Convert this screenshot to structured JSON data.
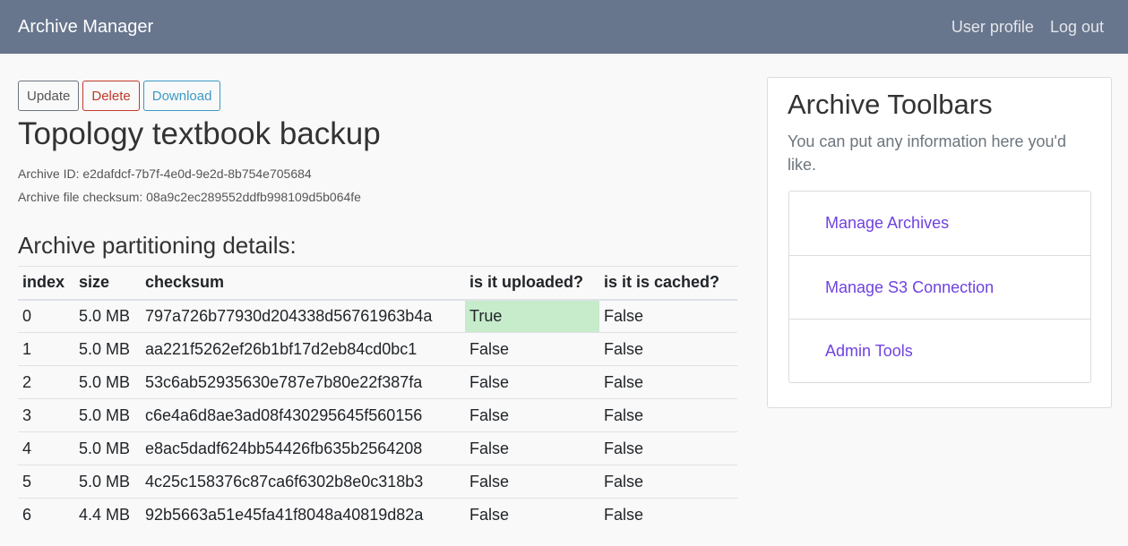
{
  "navbar": {
    "brand": "Archive Manager",
    "links": [
      "User profile",
      "Log out"
    ]
  },
  "actions": {
    "update_label": "Update",
    "delete_label": "Delete",
    "download_label": "Download"
  },
  "archive": {
    "title": "Topology textbook backup",
    "id_text": "Archive ID: e2dafdcf-7b7f-4e0d-9e2d-8b754e705684",
    "checksum_text": "Archive file checksum: 08a9c2ec289552ddfb998109d5b064fe"
  },
  "partitions": {
    "heading": "Archive partitioning details:",
    "columns": [
      "index",
      "size",
      "checksum",
      "is it uploaded?",
      "is it is cached?"
    ],
    "rows": [
      [
        "0",
        "5.0 MB",
        "797a726b77930d204338d56761963b4a",
        "True",
        "False"
      ],
      [
        "1",
        "5.0 MB",
        "aa221f5262ef26b1bf17d2eb84cd0bc1",
        "False",
        "False"
      ],
      [
        "2",
        "5.0 MB",
        "53c6ab52935630e787e7b80e22f387fa",
        "False",
        "False"
      ],
      [
        "3",
        "5.0 MB",
        "c6e4a6d8ae3ad08f430295645f560156",
        "False",
        "False"
      ],
      [
        "4",
        "5.0 MB",
        "e8ac5dadf624bb54426fb635b2564208",
        "False",
        "False"
      ],
      [
        "5",
        "5.0 MB",
        "4c25c158376c87ca6f6302b8e0c318b3",
        "False",
        "False"
      ],
      [
        "6",
        "4.4 MB",
        "92b5663a51e45fa41f8048a40819d82a",
        "False",
        "False"
      ]
    ]
  },
  "sidebar": {
    "title": "Archive Toolbars",
    "text": "You can put any information here you'd like.",
    "links": [
      "Manage Archives",
      "Manage S3 Connection",
      "Admin Tools"
    ]
  },
  "colors": {
    "navbar": "#67758d",
    "uploaded_true_bg": "#c6eccb",
    "link": "#6f42e1"
  }
}
